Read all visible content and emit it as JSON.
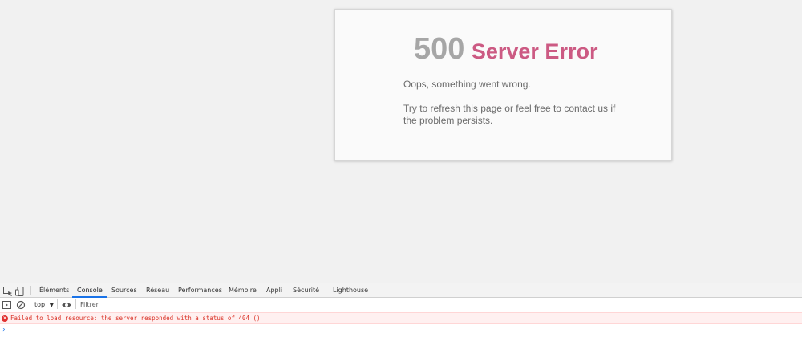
{
  "page": {
    "error_code": "500",
    "error_label": "Server Error",
    "message": "Oops, something went wrong.",
    "help": "Try to refresh this page or feel free to contact us if the problem persists."
  },
  "devtools": {
    "tabs": [
      {
        "label": "Éléments",
        "active": false
      },
      {
        "label": "Console",
        "active": true
      },
      {
        "label": "Sources",
        "active": false
      },
      {
        "label": "Réseau",
        "active": false
      },
      {
        "label": "Performances",
        "active": false
      },
      {
        "label": "Mémoire",
        "active": false
      },
      {
        "label": "Appli",
        "active": false
      },
      {
        "label": "Sécurité",
        "active": false
      },
      {
        "label": "Lighthouse",
        "active": false
      }
    ],
    "toolbar": {
      "context": "top",
      "filter_placeholder": "Filtrer"
    },
    "console": {
      "error_message": "Failed to load resource: the server responded with a status of 404 ()",
      "prompt_symbol": "›"
    }
  }
}
